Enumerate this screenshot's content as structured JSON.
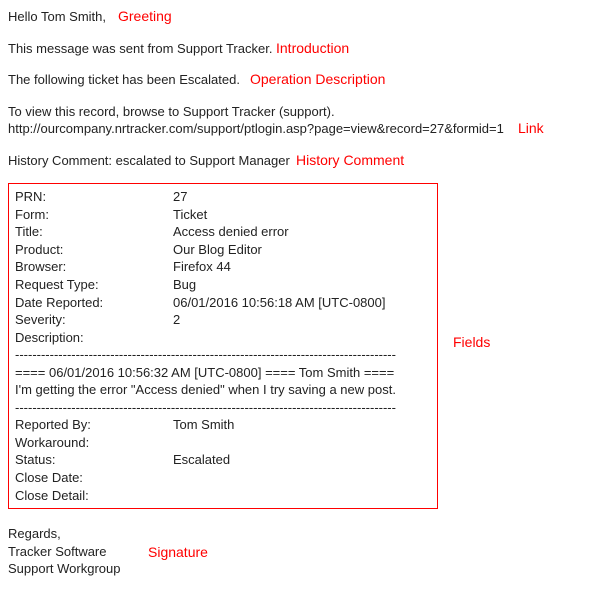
{
  "greeting": {
    "text": "Hello Tom Smith,",
    "annotation": "Greeting"
  },
  "introduction": {
    "text": "This message was sent from Support Tracker.",
    "annotation": "Introduction"
  },
  "operation": {
    "text": "The following ticket has been Escalated.",
    "annotation": "Operation Description"
  },
  "link": {
    "line1": "To view this record, browse to Support Tracker (support).",
    "url": "http://ourcompany.nrtracker.com/support/ptlogin.asp?page=view&record=27&formid=1",
    "annotation": "Link"
  },
  "history": {
    "label": "History Comment:",
    "text": "escalated to Support Manager",
    "annotation": "History Comment"
  },
  "fields": {
    "annotation": "Fields",
    "rows1": [
      {
        "label": "PRN:",
        "value": "27"
      },
      {
        "label": "Form:",
        "value": "Ticket"
      },
      {
        "label": "Title:",
        "value": "Access denied error"
      },
      {
        "label": "Product:",
        "value": "Our Blog Editor"
      },
      {
        "label": "Browser:",
        "value": "Firefox 44"
      },
      {
        "label": "Request Type:",
        "value": "Bug"
      },
      {
        "label": "Date Reported:",
        "value": "06/01/2016 10:56:18 AM [UTC-0800]"
      },
      {
        "label": "Severity:",
        "value": "2"
      },
      {
        "label": "Description:",
        "value": ""
      }
    ],
    "desc_block": {
      "dash": "----------------------------------------------------------------------------------------",
      "line1": "==== 06/01/2016 10:56:32 AM [UTC-0800] ==== Tom Smith ====",
      "line2": "I'm getting the error \"Access denied\" when I try saving a new post.",
      "dash2": "----------------------------------------------------------------------------------------"
    },
    "rows2": [
      {
        "label": "Reported By:",
        "value": "Tom Smith"
      },
      {
        "label": "Workaround:",
        "value": ""
      },
      {
        "label": "Status:",
        "value": "Escalated"
      },
      {
        "label": "Close Date:",
        "value": ""
      },
      {
        "label": "Close Detail:",
        "value": ""
      }
    ]
  },
  "signature": {
    "line1": "Regards,",
    "line2": "Tracker Software",
    "line3": "Support Workgroup",
    "annotation": "Signature"
  }
}
